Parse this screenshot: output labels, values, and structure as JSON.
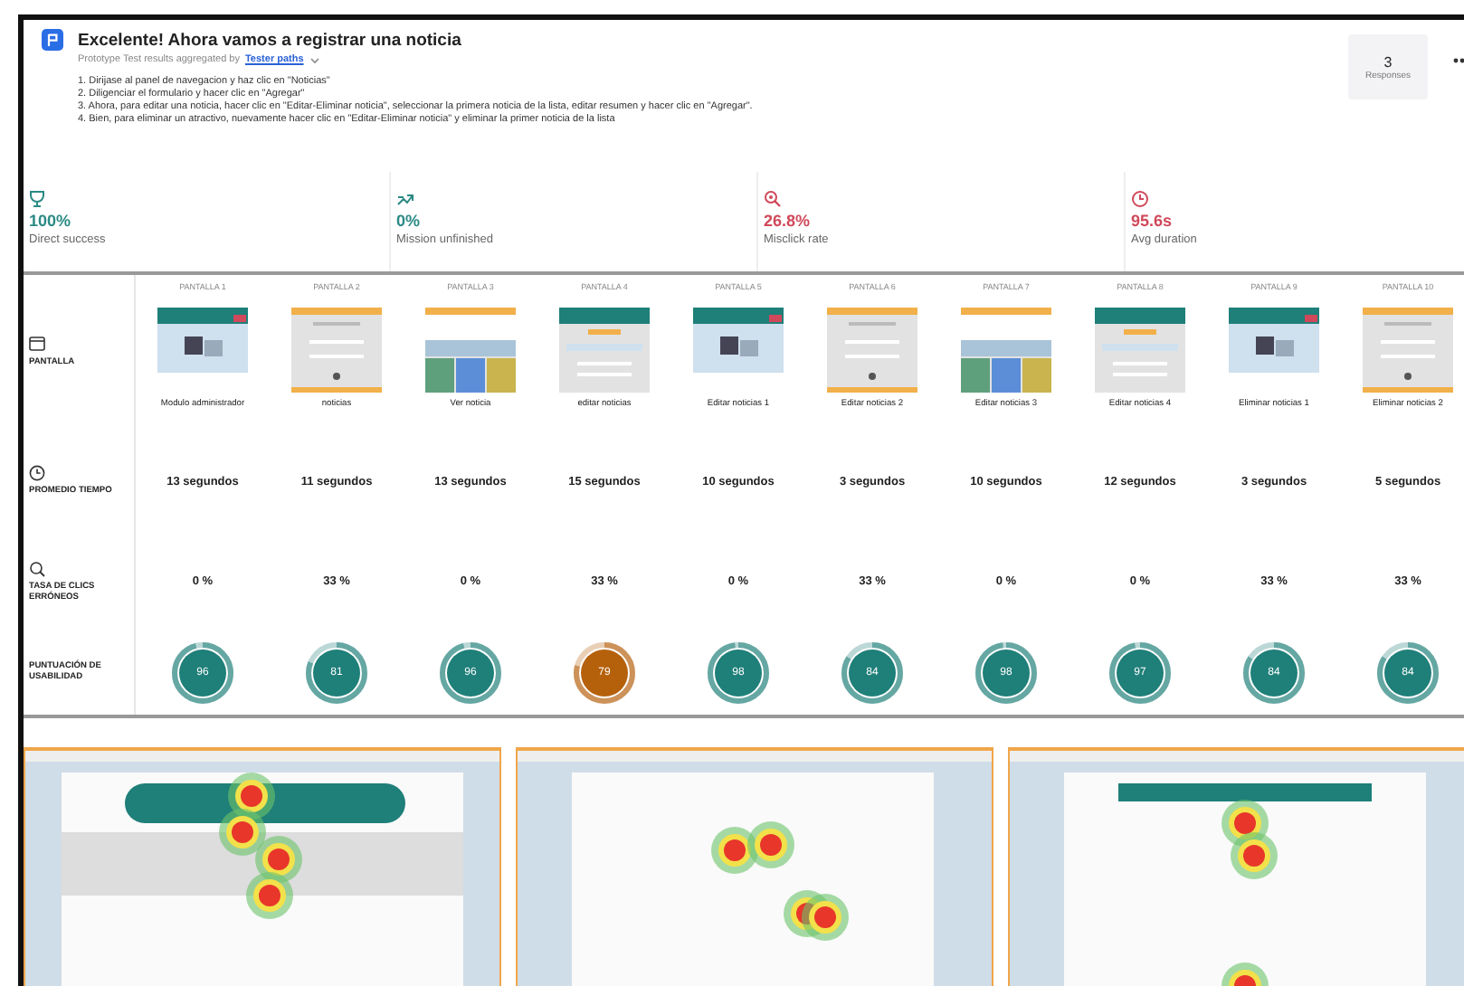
{
  "header": {
    "title": "Excelente! Ahora vamos a registrar una noticia",
    "subtitle": "Prototype Test results aggregated by",
    "subtitle_link": "Tester paths",
    "steps": [
      "1. Dirijase al panel de navegacion y haz clic en \"Noticias\"",
      "2. Diligenciar el formulario y hacer clic en \"Agregar\"",
      "3. Ahora, para editar una noticia, hacer clic en \"Editar-Eliminar noticia\", seleccionar la primera noticia de la lista, editar resumen y hacer clic en \"Agregar\".",
      "4. Bien, para eliminar un atractivo, nuevamente hacer clic en \"Editar-Eliminar noticia\" y eliminar la primer noticia de la lista"
    ],
    "responses": {
      "count": "3",
      "label": "Responses"
    }
  },
  "metrics": [
    {
      "kind": "success",
      "value": "100%",
      "label": "Direct success",
      "color": "#2a8a84"
    },
    {
      "kind": "unfinished",
      "value": "0%",
      "label": "Mission unfinished",
      "color": "#2a8a84"
    },
    {
      "kind": "misclick",
      "value": "26.8%",
      "label": "Misclick rate",
      "color": "#d0485a"
    },
    {
      "kind": "duration",
      "value": "95.6s",
      "label": "Avg duration",
      "color": "#d0485a"
    }
  ],
  "table": {
    "rows": [
      {
        "kind": "screen",
        "label": "PANTALLA"
      },
      {
        "kind": "time",
        "label": "PROMEDIO TIEMPO"
      },
      {
        "kind": "misclick",
        "label": "TASA DE CLICS ERRÓNEOS"
      },
      {
        "kind": "score",
        "label": "PUNTUACIÓN DE USABILIDAD"
      }
    ],
    "columns": [
      {
        "header": "PANTALLA 1",
        "screen": "Modulo administrador",
        "time": "13 segundos",
        "misclick": "0 %",
        "score": "96",
        "level": 0.96,
        "color": "#1f7f79"
      },
      {
        "header": "PANTALLA 2",
        "screen": "noticias",
        "time": "11 segundos",
        "misclick": "33 %",
        "score": "81",
        "level": 0.81,
        "color": "#1f7f79"
      },
      {
        "header": "PANTALLA 3",
        "screen": "Ver noticia",
        "time": "13 segundos",
        "misclick": "0 %",
        "score": "96",
        "level": 0.96,
        "color": "#1f7f79"
      },
      {
        "header": "PANTALLA 4",
        "screen": "editar noticias",
        "time": "15 segundos",
        "misclick": "33 %",
        "score": "79",
        "level": 0.79,
        "color": "#b5610c"
      },
      {
        "header": "PANTALLA 5",
        "screen": "Editar noticias 1",
        "time": "10 segundos",
        "misclick": "0 %",
        "score": "98",
        "level": 0.98,
        "color": "#1f7f79"
      },
      {
        "header": "PANTALLA 6",
        "screen": "Editar noticias 2",
        "time": "3 segundos",
        "misclick": "33 %",
        "score": "84",
        "level": 0.84,
        "color": "#1f7f79"
      },
      {
        "header": "PANTALLA 7",
        "screen": "Editar noticias 3",
        "time": "10 segundos",
        "misclick": "0 %",
        "score": "98",
        "level": 0.98,
        "color": "#1f7f79"
      },
      {
        "header": "PANTALLA 8",
        "screen": "Editar noticias 4",
        "time": "12 segundos",
        "misclick": "0 %",
        "score": "97",
        "level": 0.97,
        "color": "#1f7f79"
      },
      {
        "header": "PANTALLA 9",
        "screen": "Eliminar noticias 1",
        "time": "3 segundos",
        "misclick": "33 %",
        "score": "84",
        "level": 0.84,
        "color": "#1f7f79"
      },
      {
        "header": "PANTALLA 10",
        "screen": "Eliminar noticias 2",
        "time": "5 segundos",
        "misclick": "33 %",
        "score": "84",
        "level": 0.84,
        "color": "#1f7f79"
      }
    ]
  }
}
